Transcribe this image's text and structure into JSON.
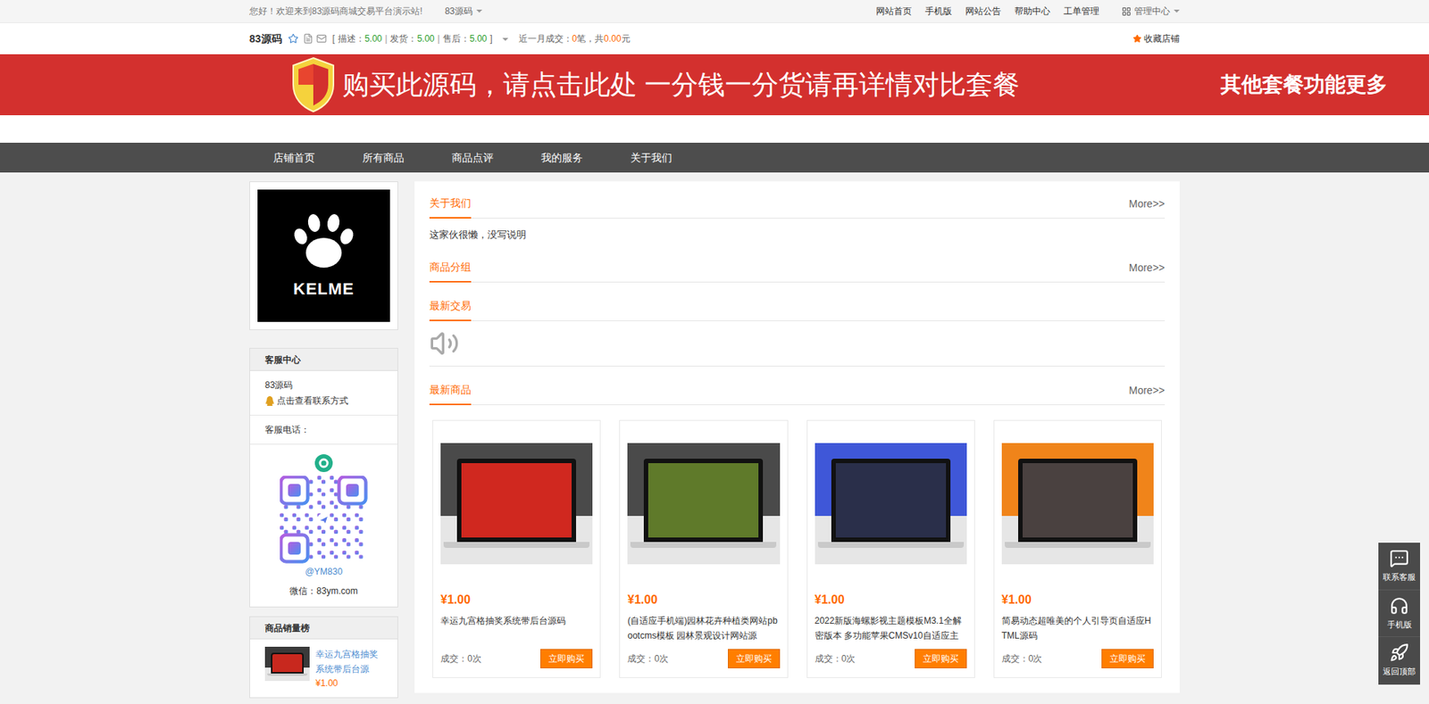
{
  "top_bar": {
    "welcome": "您好！欢迎来到83源码商城交易平台演示站!",
    "site_menu": "83源码",
    "links": [
      "网站首页",
      "手机版",
      "网站公告",
      "帮助中心",
      "工单管理"
    ],
    "admin": "管理中心"
  },
  "shop_header": {
    "name": "83源码",
    "bracket_open": "[",
    "bracket_close": "]",
    "separator": "|",
    "ratings": [
      {
        "label": "描述：",
        "value": "5.00"
      },
      {
        "label": "发货：",
        "value": "5.00"
      },
      {
        "label": "售后：",
        "value": "5.00"
      }
    ],
    "recent_label": "近一月成交：",
    "recent_count": "0",
    "recent_mid": "笔，共",
    "recent_amount": "0.00",
    "recent_unit": "元",
    "favorite": "收藏店铺"
  },
  "banner": {
    "text": "购买此源码，请点击此处 一分钱一分货请再详情对比套餐",
    "side": "其他套餐功能更多"
  },
  "nav": [
    "店铺首页",
    "所有商品",
    "商品点评",
    "我的服务",
    "关于我们"
  ],
  "logo_text": "KELME",
  "service": {
    "title": "客服中心",
    "name": "83源码",
    "contact": "点击查看联系方式",
    "phone_label": "客服电话：",
    "qr_handle": "@YM830",
    "wechat": "微信：83ym.com"
  },
  "ranking": {
    "title": "商品销量榜",
    "items": [
      {
        "title": "幸运九宫格抽奖系统带后台源",
        "price": "¥1.00",
        "color": "#c8281e"
      }
    ]
  },
  "about": {
    "title": "关于我们",
    "more": "More>>",
    "text": "这家伙很懒，没写说明"
  },
  "groups": {
    "title": "商品分组",
    "more": "More>>"
  },
  "trades": {
    "title": "最新交易"
  },
  "latest": {
    "title": "最新商品",
    "more": "More>>"
  },
  "products": [
    {
      "price": "¥1.00",
      "title": "幸运九宫格抽奖系统带后台源码",
      "sales": "成交：0次",
      "button": "立即购买",
      "color": "#4a4a4a",
      "screen": "#d0281f"
    },
    {
      "price": "¥1.00",
      "title": "(自适应手机端)园林花卉种植类网站pbootcms模板 园林景观设计网站源",
      "sales": "成交：0次",
      "button": "立即购买",
      "color": "#4a4a4a",
      "screen": "#5f7a2a"
    },
    {
      "price": "¥1.00",
      "title": "2022新版海螺影视主题模板M3.1全解密版本 多功能苹果CMSv10自适应主",
      "sales": "成交：0次",
      "button": "立即购买",
      "color": "#3f57d8",
      "screen": "#2a2f4a"
    },
    {
      "price": "¥1.00",
      "title": "简易动态超唯美的个人引导页自适应HTML源码",
      "sales": "成交：0次",
      "button": "立即购买",
      "color": "#f0841a",
      "screen": "#4a4140"
    }
  ],
  "float_tools": [
    {
      "label": "联系客服"
    },
    {
      "label": "手机版"
    },
    {
      "label": "返回顶部"
    }
  ]
}
